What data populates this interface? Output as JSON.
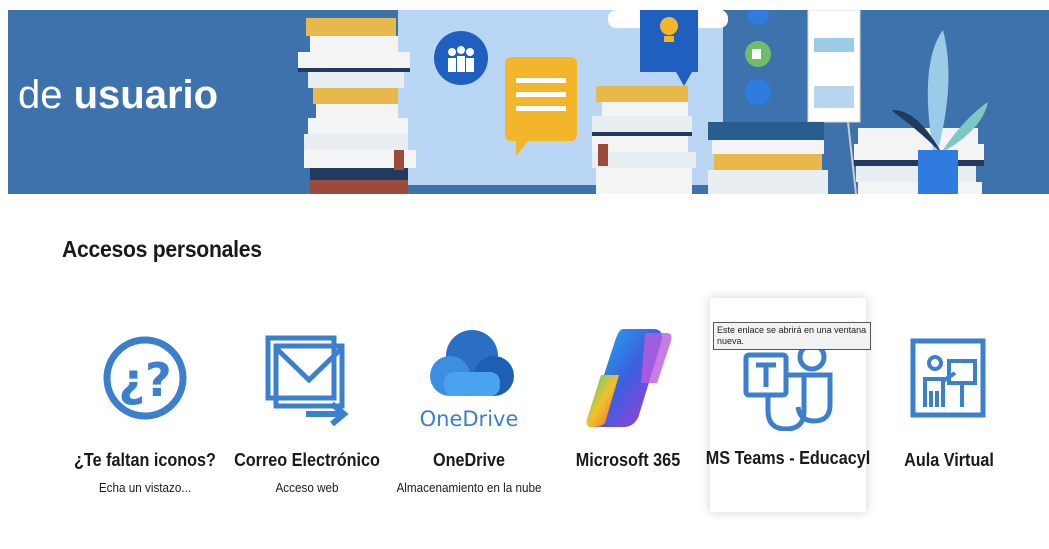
{
  "banner": {
    "title_light": "de ",
    "title_bold": "usuario",
    "background_color": "#3e72ad"
  },
  "section": {
    "title": "Accesos personales"
  },
  "tiles": [
    {
      "label": "¿Te faltan iconos?",
      "sub": "Echa un vistazo...",
      "icon": "question-circle-icon"
    },
    {
      "label": "Correo Electrónico",
      "sub": "Acceso web",
      "icon": "mail-forward-icon"
    },
    {
      "label": "OneDrive",
      "sub": "Almacenamiento en la nube",
      "icon": "onedrive-icon",
      "icon_text": "OneDrive"
    },
    {
      "label": "Microsoft 365",
      "sub": "",
      "icon": "microsoft-365-icon"
    },
    {
      "label": "MS Teams - Educacyl",
      "sub": "",
      "icon": "teams-icon",
      "hovered": true
    },
    {
      "label": "Aula Virtual",
      "sub": "",
      "icon": "virtual-classroom-icon"
    }
  ],
  "tooltip": {
    "text": "Este enlace se abrirá en una ventana nueva."
  },
  "colors": {
    "accent_blue": "#3b7fcf",
    "text": "#1a1a1a"
  }
}
